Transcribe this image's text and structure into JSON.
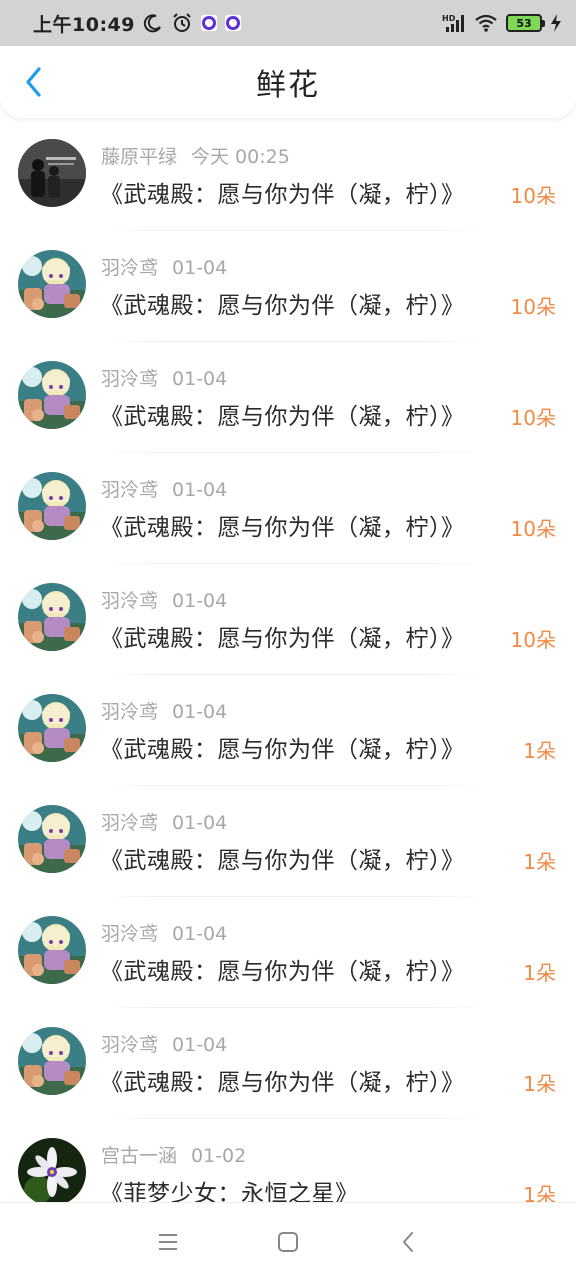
{
  "status_bar": {
    "time": "上午10:49",
    "battery": "53",
    "icons": [
      "moon-icon",
      "alarm-icon",
      "app-notification-icon",
      "app-notification-icon",
      "hd-signal-icon",
      "wifi-icon",
      "battery-icon",
      "charging-icon"
    ]
  },
  "header": {
    "title": "鲜花",
    "back_icon": "chevron-left-icon"
  },
  "rows": [
    {
      "user": "藤原平绿",
      "date": "今天 00:25",
      "book": "《武魂殿：愿与你为伴（凝，柠）》",
      "count": "10朵",
      "avatar": "bw-photo"
    },
    {
      "user": "羽泠鸢",
      "date": "01-04",
      "book": "《武魂殿：愿与你为伴（凝，柠）》",
      "count": "10朵",
      "avatar": "anime"
    },
    {
      "user": "羽泠鸢",
      "date": "01-04",
      "book": "《武魂殿：愿与你为伴（凝，柠）》",
      "count": "10朵",
      "avatar": "anime"
    },
    {
      "user": "羽泠鸢",
      "date": "01-04",
      "book": "《武魂殿：愿与你为伴（凝，柠）》",
      "count": "10朵",
      "avatar": "anime"
    },
    {
      "user": "羽泠鸢",
      "date": "01-04",
      "book": "《武魂殿：愿与你为伴（凝，柠）》",
      "count": "10朵",
      "avatar": "anime"
    },
    {
      "user": "羽泠鸢",
      "date": "01-04",
      "book": "《武魂殿：愿与你为伴（凝，柠）》",
      "count": "1朵",
      "avatar": "anime"
    },
    {
      "user": "羽泠鸢",
      "date": "01-04",
      "book": "《武魂殿：愿与你为伴（凝，柠）》",
      "count": "1朵",
      "avatar": "anime"
    },
    {
      "user": "羽泠鸢",
      "date": "01-04",
      "book": "《武魂殿：愿与你为伴（凝，柠）》",
      "count": "1朵",
      "avatar": "anime"
    },
    {
      "user": "羽泠鸢",
      "date": "01-04",
      "book": "《武魂殿：愿与你为伴（凝，柠）》",
      "count": "1朵",
      "avatar": "anime"
    },
    {
      "user": "宫古一涵",
      "date": "01-02",
      "book": "《菲梦少女：永恒之星》",
      "count": "1朵",
      "avatar": "flower"
    }
  ],
  "nav_bar": {
    "icons": [
      "menu-icon",
      "home-icon",
      "back-icon"
    ]
  },
  "colors": {
    "accent": "#1a9cf0",
    "count": "#f08a45",
    "meta": "#a8a8a8",
    "status_bg": "#d3d3d3"
  }
}
